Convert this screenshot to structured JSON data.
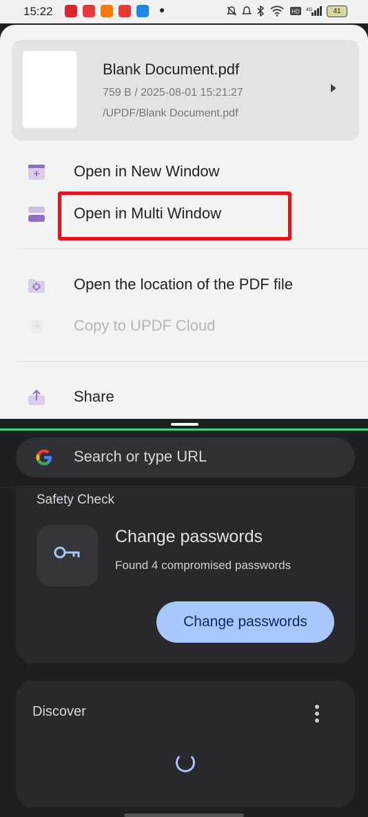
{
  "status_bar": {
    "time": "15:22",
    "icons": [
      "notifications-off-icon",
      "bluetooth-icon",
      "wifi-icon",
      "hd-icon",
      "4g-signal-icon"
    ],
    "battery": "41",
    "app_icon_colors": [
      "#d9232d",
      "#e53935",
      "#f57c00",
      "#e53935",
      "#1e88e5"
    ]
  },
  "file_card": {
    "name": "Blank Document.pdf",
    "meta": "759 B / 2025-08-01 15:21:27",
    "path": "/UPDF/Blank Document.pdf"
  },
  "menu": {
    "open_new_window": "Open in New Window",
    "open_multi_window": "Open in Multi Window",
    "open_location": "Open the location of the PDF file",
    "copy_cloud": "Copy to UPDF Cloud",
    "share": "Share"
  },
  "browser": {
    "omnibox_placeholder": "Search or type URL",
    "safety_check": {
      "title": "Safety Check",
      "heading": "Change passwords",
      "subtitle": "Found 4 compromised passwords",
      "button": "Change passwords"
    },
    "discover": {
      "title": "Discover"
    }
  },
  "colors": {
    "accent_purple": "#8e6ebd",
    "highlight_red": "#e0151e",
    "button_blue": "#a8c7fa",
    "split_green": "#3ddc84"
  }
}
